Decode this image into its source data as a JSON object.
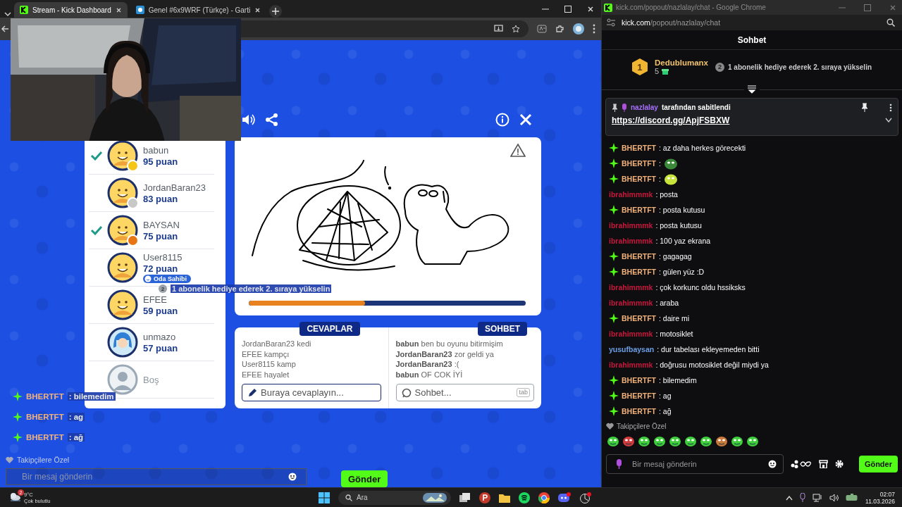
{
  "browser": {
    "tabs": [
      {
        "title": "Stream - Kick Dashboard",
        "selected": true
      },
      {
        "title": "Genel #6x9WRF (Türkçe) - Garti",
        "selected": false
      }
    ]
  },
  "game": {
    "players": [
      {
        "kind": "player",
        "name": "babun",
        "points": "95 puan",
        "guessed": true,
        "color": "#f5c518"
      },
      {
        "kind": "player",
        "name": "JordanBaran23",
        "points": "83 puan",
        "guessed": false,
        "color": "#c8c8c8"
      },
      {
        "kind": "player",
        "name": "BAYSAN",
        "points": "75 puan",
        "guessed": true,
        "color": "#e87511"
      },
      {
        "kind": "player",
        "name": "User8115",
        "points": "72 puan",
        "guessed": false,
        "badge": "Oda Sahibi"
      },
      {
        "kind": "player",
        "name": "EFEE",
        "points": "59 puan",
        "guessed": false
      },
      {
        "kind": "custom",
        "name": "unmazo",
        "points": "57 puan",
        "guessed": false
      },
      {
        "kind": "empty",
        "name": "Boş"
      }
    ],
    "progress": {
      "level": 0.42
    },
    "answers_tab": "CEVAPLAR",
    "chat_tab": "SOHBET",
    "answers": [
      {
        "user": "JordanBaran23",
        "text": "kedi"
      },
      {
        "user": "EFEE",
        "text": "kampçı"
      },
      {
        "user": "User8115",
        "text": "kamp"
      },
      {
        "user": "EFEE",
        "text": "hayalet"
      }
    ],
    "answer_placeholder": "Buraya cevaplayın...",
    "chat": [
      {
        "user": "babun",
        "text": "ben bu oyunu bitirmişim"
      },
      {
        "user": "JordanBaran23",
        "text": "zor geldi ya"
      },
      {
        "user": "JordanBaran23",
        "text": ":("
      },
      {
        "user": "babun",
        "text": "OF COK İYİ"
      }
    ],
    "chat_placeholder": "Sohbet...",
    "chat_key": "tab"
  },
  "overlay": {
    "gift_rank": "2",
    "gift_prompt": "1 abonelik hediye ederek 2. sıraya yükselin",
    "messages": [
      {
        "user": "BHERTFT",
        "text": ": bilemedim"
      },
      {
        "user": "BHERTFT",
        "text": ": ag"
      },
      {
        "user": "BHERTFT",
        "text": ": ağ"
      }
    ],
    "section": "Takipçilere Özel",
    "placeholder": "Bir mesaj gönderin",
    "send": "Gönder"
  },
  "chat_window": {
    "title": "kick.com/popout/nazlalay/chat - Google Chrome",
    "url_host": "kick.com",
    "url_path": "/popout/nazlalay/chat",
    "header": "Sohbet",
    "leader": {
      "rank": "1",
      "name": "Dedublumanx",
      "count": "5"
    },
    "next_rank": "2",
    "gift_prompt": "1 abonelik hediye ederek 2. sıraya yükselin",
    "pinned": {
      "by": "nazlalay",
      "label": "tarafından sabitlendi",
      "link": "https://discord.gg/ApjFSBXW"
    },
    "messages": [
      {
        "kind": "text",
        "user": "BHERTFT",
        "color": "#f2b27a",
        "badge": true,
        "text": ": az daha herkes görecekti"
      },
      {
        "kind": "emote",
        "user": "BHERTFT",
        "color": "#f2b27a",
        "badge": true,
        "text": ":"
      },
      {
        "kind": "emote",
        "user": "BHERTFT",
        "color": "#f2b27a",
        "badge": true,
        "text": ":"
      },
      {
        "kind": "text",
        "user": "ibrahimmmk",
        "color": "#c8173c",
        "badge": false,
        "text": ": posta"
      },
      {
        "kind": "text",
        "user": "BHERTFT",
        "color": "#f2b27a",
        "badge": true,
        "text": ": posta kutusu"
      },
      {
        "kind": "text",
        "user": "ibrahimmmk",
        "color": "#c8173c",
        "badge": false,
        "text": ": posta kutusu"
      },
      {
        "kind": "text",
        "user": "ibrahimmmk",
        "color": "#c8173c",
        "badge": false,
        "text": ": 100 yaz ekrana"
      },
      {
        "kind": "text",
        "user": "BHERTFT",
        "color": "#f2b27a",
        "badge": true,
        "text": ": gagagag"
      },
      {
        "kind": "text",
        "user": "BHERTFT",
        "color": "#f2b27a",
        "badge": true,
        "text": ": gülen yüz :D"
      },
      {
        "kind": "text",
        "user": "ibrahimmmk",
        "color": "#c8173c",
        "badge": false,
        "text": ": çok korkunc oldu hssiksks"
      },
      {
        "kind": "text",
        "user": "ibrahimmmk",
        "color": "#c8173c",
        "badge": false,
        "text": ": araba"
      },
      {
        "kind": "text",
        "user": "BHERTFT",
        "color": "#f2b27a",
        "badge": true,
        "text": ": daire mi"
      },
      {
        "kind": "text",
        "user": "ibrahimmmk",
        "color": "#c8173c",
        "badge": false,
        "text": ": motosiklet"
      },
      {
        "kind": "text",
        "user": "yusufbaysan",
        "color": "#6b9fe6",
        "badge": false,
        "text": ": dur tabelası ekleyemeden bitti"
      },
      {
        "kind": "text",
        "user": "ibrahimmmk",
        "color": "#c8173c",
        "badge": false,
        "text": ": doğrusu motosiklet değil miydi ya"
      },
      {
        "kind": "text",
        "user": "BHERTFT",
        "color": "#f2b27a",
        "badge": true,
        "text": ": bilemedim"
      },
      {
        "kind": "text",
        "user": "BHERTFT",
        "color": "#f2b27a",
        "badge": true,
        "text": ": ag"
      },
      {
        "kind": "text",
        "user": "BHERTFT",
        "color": "#f2b27a",
        "badge": true,
        "text": ": ağ"
      }
    ],
    "section": "Takipçilere Özel",
    "placeholder": "Bir mesaj gönderin",
    "send": "Gönder"
  },
  "taskbar": {
    "weather_badge": "2",
    "temperature": "9°C",
    "weather": "Çok bulutlu",
    "search": "Ara",
    "time": "02:07",
    "date": "11.03.2026"
  }
}
